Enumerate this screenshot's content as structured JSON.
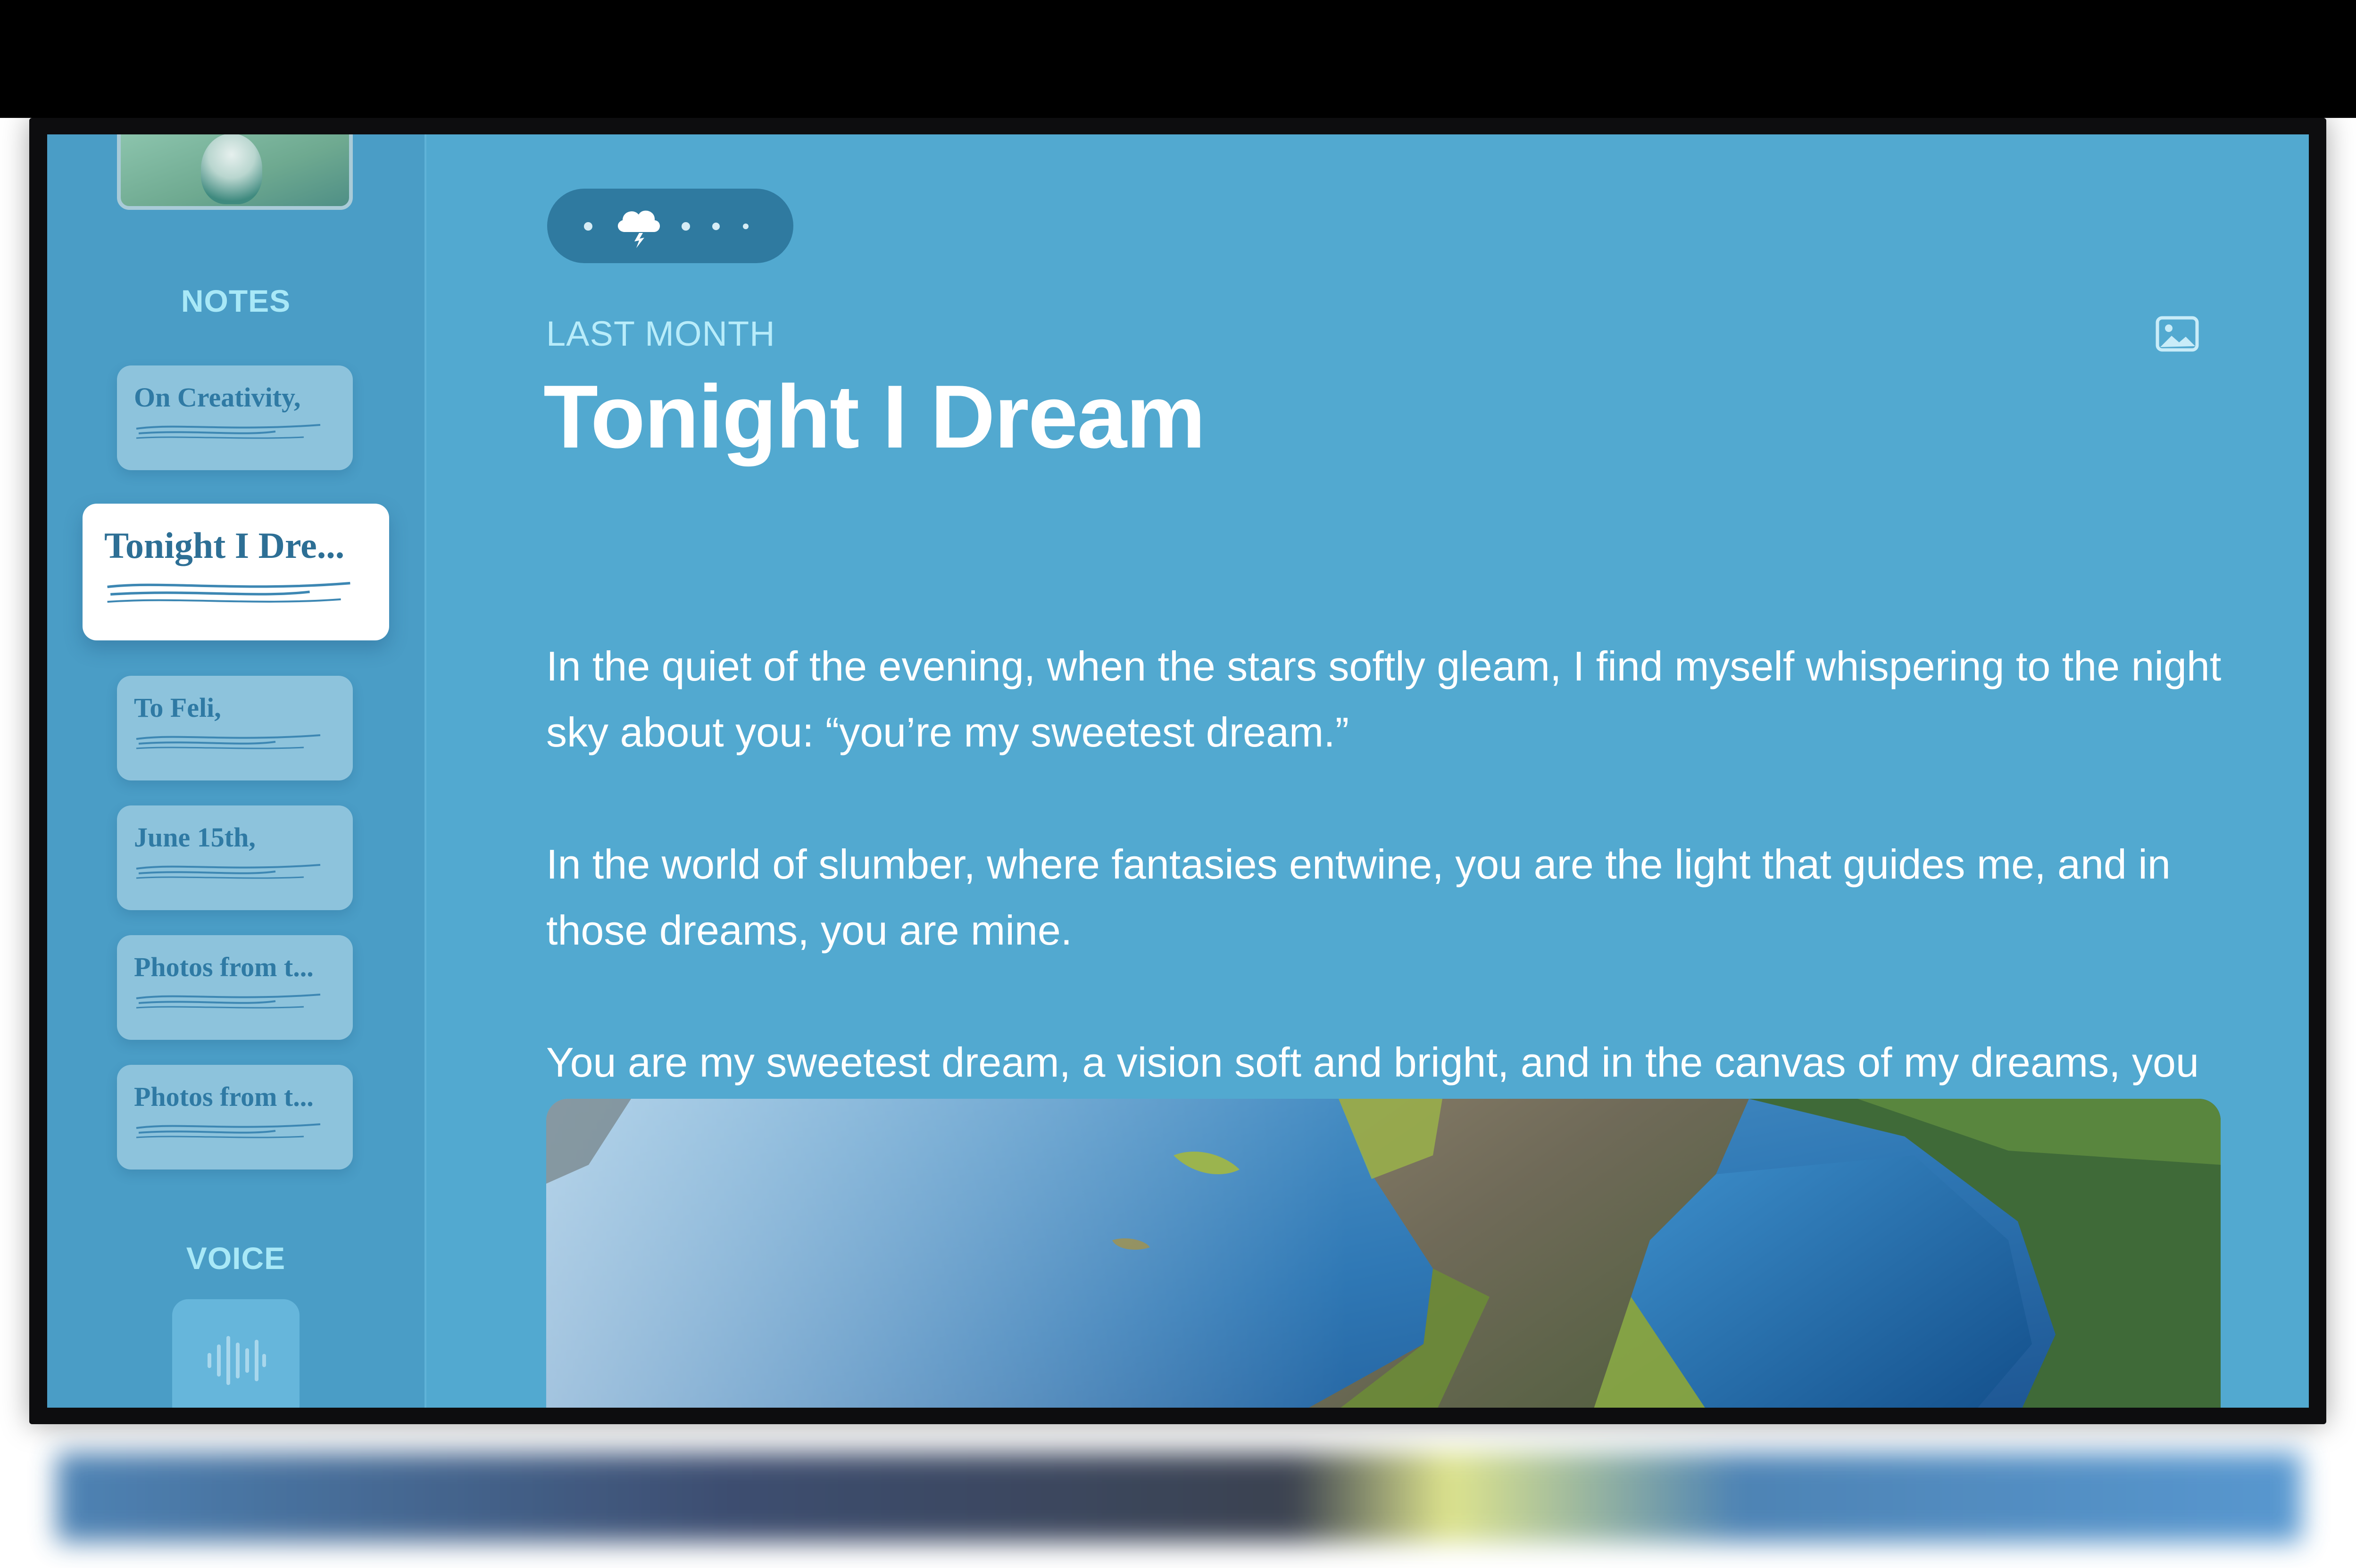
{
  "sidebar": {
    "notes_heading": "NOTES",
    "voice_heading": "VOICE",
    "notes": [
      {
        "title": "On Creativity,"
      },
      {
        "title": "Tonight I Dre..."
      },
      {
        "title": "To Feli,"
      },
      {
        "title": "June 15th,"
      },
      {
        "title": "Photos from t..."
      },
      {
        "title": "Photos from t..."
      }
    ],
    "selected_index": 1
  },
  "main": {
    "date_label": "LAST MONTH",
    "title": "Tonight I Dream",
    "paragraphs": [
      "In the quiet of the evening, when the stars softly gleam, I find myself whispering to the night sky about you: “you’re my sweetest dream.”",
      "In the world of slumber, where fantasies entwine, you are the light that guides me, and in those dreams, you are mine.",
      "You are my sweetest dream, a vision soft and bright, and in the canvas of my dreams, you paint the night with such warm glow."
    ],
    "weather_pill": {
      "icon": "thunderstorm-cloud-icon"
    },
    "image_toggle_icon": "photo-icon"
  },
  "colors": {
    "screen_bg": "#52a9d0",
    "sidebar_bg": "#4a9dc6",
    "accent_label": "#a8e8f7",
    "pill_bg": "#2f7aa0"
  }
}
